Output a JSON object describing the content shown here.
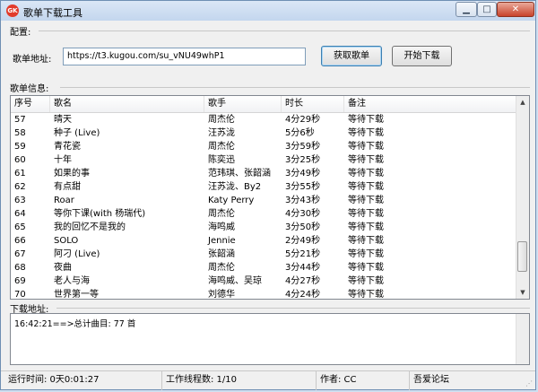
{
  "window": {
    "title": "歌单下载工具",
    "app_icon_text": "GK",
    "controls": {
      "minimize": "▁",
      "maximize": "□",
      "close": "✕"
    }
  },
  "config": {
    "section_label": "配置:",
    "url_label": "歌单地址:",
    "url_value": "https://t3.kugou.com/su_vNU49whP1",
    "fetch_button": "获取歌单",
    "start_button": "开始下载"
  },
  "songs": {
    "section_label": "歌单信息:",
    "columns": [
      "序号",
      "歌名",
      "歌手",
      "时长",
      "备注"
    ],
    "rows": [
      [
        "57",
        "晴天",
        "周杰伦",
        "4分29秒",
        "等待下载"
      ],
      [
        "58",
        "种子 (Live)",
        "汪苏泷",
        "5分6秒",
        "等待下载"
      ],
      [
        "59",
        "青花瓷",
        "周杰伦",
        "3分59秒",
        "等待下载"
      ],
      [
        "60",
        "十年",
        "陈奕迅",
        "3分25秒",
        "等待下载"
      ],
      [
        "61",
        "如果的事",
        "范玮琪、张韶涵",
        "3分49秒",
        "等待下载"
      ],
      [
        "62",
        "有点甜",
        "汪苏泷、By2",
        "3分55秒",
        "等待下载"
      ],
      [
        "63",
        "Roar",
        "Katy Perry",
        "3分43秒",
        "等待下载"
      ],
      [
        "64",
        "等你下课(with 杨瑞代)",
        "周杰伦",
        "4分30秒",
        "等待下载"
      ],
      [
        "65",
        "我的回忆不是我的",
        "海鸣威",
        "3分50秒",
        "等待下载"
      ],
      [
        "66",
        "SOLO",
        "Jennie",
        "2分49秒",
        "等待下载"
      ],
      [
        "67",
        "阿刁 (Live)",
        "张韶涵",
        "5分21秒",
        "等待下载"
      ],
      [
        "68",
        "夜曲",
        "周杰伦",
        "3分44秒",
        "等待下载"
      ],
      [
        "69",
        "老人与海",
        "海鸣威、吴琼",
        "4分27秒",
        "等待下载"
      ],
      [
        "70",
        "世界第一等",
        "刘德华",
        "4分24秒",
        "等待下载"
      ]
    ],
    "scroll_position": 0.9
  },
  "download": {
    "section_label": "下载地址:",
    "log_lines": [
      "16:42:21==>总计曲目: 77 首"
    ]
  },
  "status_bar": {
    "runtime": "运行时间: 0天0:01:27",
    "threads": "工作线程数: 1/10",
    "author": "作者: CC",
    "forum": "吾爱论坛"
  }
}
